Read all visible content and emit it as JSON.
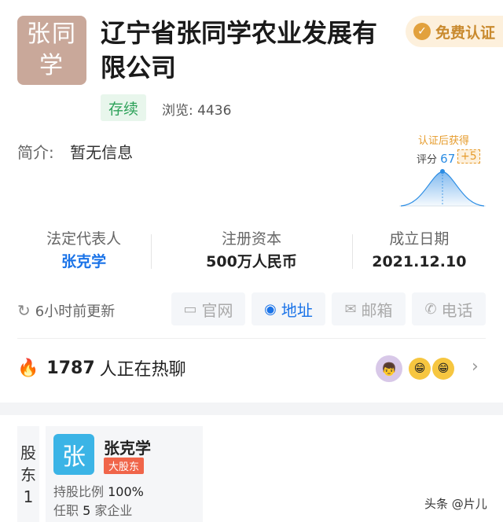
{
  "company": {
    "logo_text": "张同学",
    "name": "辽宁省张同学农业发展有限公司",
    "cert_badge": "免费认证",
    "status": "存续",
    "views_label": "浏览:",
    "views": "4436",
    "intro_label": "简介:",
    "intro": "暂无信息"
  },
  "score": {
    "header": "认证后获得",
    "label": "评分",
    "value": "67",
    "bonus": "+5"
  },
  "info": [
    {
      "key": "法定代表人",
      "value": "张克学"
    },
    {
      "key": "注册资本",
      "value": "500万人民币"
    },
    {
      "key": "成立日期",
      "value": "2021.12.10"
    }
  ],
  "update": {
    "text": "6小时前更新"
  },
  "quick_links": [
    {
      "label": "官网",
      "icon": "monitor-icon",
      "icon_glyph": "▭"
    },
    {
      "label": "地址",
      "icon": "location-pin-icon",
      "icon_glyph": "◉"
    },
    {
      "label": "邮箱",
      "icon": "mail-icon",
      "icon_glyph": "✉"
    },
    {
      "label": "电话",
      "icon": "phone-icon",
      "icon_glyph": "✆"
    }
  ],
  "hot": {
    "count": "1787",
    "text": "人正在热聊"
  },
  "shareholder": {
    "section_label": "股东",
    "count": "1",
    "avatar_char": "张",
    "name": "张克学",
    "tag": "大股东",
    "ratio_label": "持股比例",
    "ratio": "100%",
    "job_label": "任职",
    "job_count": "5",
    "job_unit": "家企业"
  },
  "watermark": "头条 @片儿",
  "colors": {
    "accent": "#1a73e8",
    "status_green": "#2ea25a",
    "gold": "#e2a13d",
    "flame": "#e8453c"
  }
}
